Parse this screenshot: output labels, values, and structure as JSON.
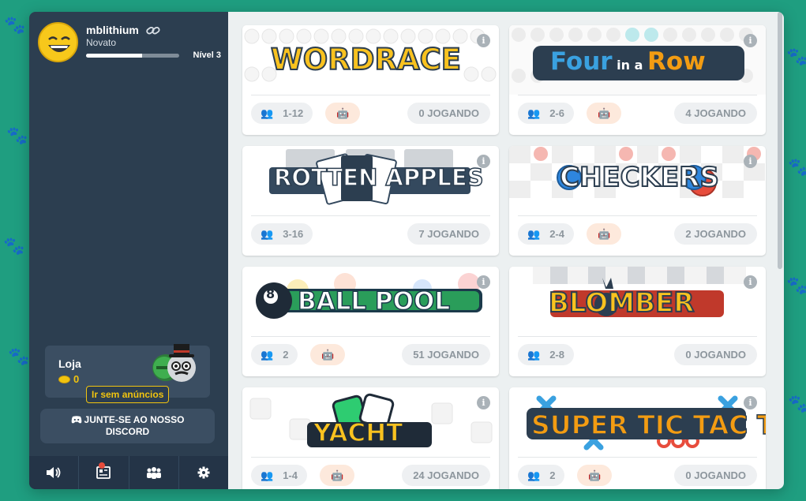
{
  "profile": {
    "username": "mblithium",
    "rank": "Novato",
    "level": "Nível 3",
    "xp_fraction": 0.6
  },
  "shop": {
    "title": "Loja",
    "coins": "0",
    "no_ads": "Ir sem anúncios"
  },
  "discord": {
    "label_line1": "JUNTE-SE AO NOSSO",
    "label_line2": "DISCORD"
  },
  "bottom_bar": [
    "speaker-icon",
    "news-icon",
    "friends-icon",
    "gear-icon"
  ],
  "games": [
    {
      "title": "WORDRACE",
      "players": "1-12",
      "bot": true,
      "playing": "0 JOGANDO"
    },
    {
      "title": "Four in a Row",
      "players": "2-6",
      "bot": true,
      "playing": "4 JOGANDO"
    },
    {
      "title": "ROTTEN APPLES",
      "players": "3-16",
      "bot": false,
      "playing": "7 JOGANDO"
    },
    {
      "title": "CHECKERS",
      "players": "2-4",
      "bot": true,
      "playing": "2 JOGANDO"
    },
    {
      "title": "BALL POOL",
      "players": "2",
      "bot": true,
      "playing": "51 JOGANDO"
    },
    {
      "title": "BLOMBER",
      "players": "2-8",
      "bot": false,
      "playing": "0 JOGANDO"
    },
    {
      "title": "YACHT",
      "players": "1-4",
      "bot": true,
      "playing": "24 JOGANDO"
    },
    {
      "title": "SUPER TIC TAC TOE",
      "players": "2",
      "bot": true,
      "playing": "0 JOGANDO"
    }
  ],
  "colors": {
    "background": "#1f9e80",
    "sidebar": "#2c3e50",
    "accent_gold": "#f1c40f",
    "bot_orange": "#f39c12"
  }
}
